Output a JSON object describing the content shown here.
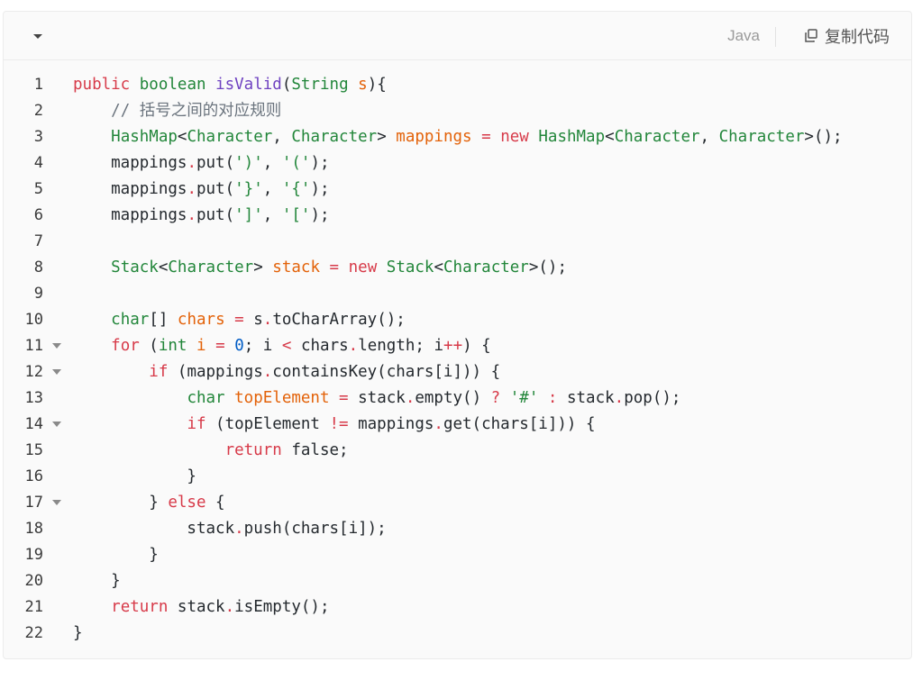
{
  "toolbar": {
    "language": "Java",
    "copy_label": "复制代码",
    "collapse_icon": "chevron-down-icon",
    "copy_icon": "copy-icon"
  },
  "colors": {
    "background": "#fafafa",
    "keyword": "#d73a49",
    "type": "#22863a",
    "function": "#6f42c1",
    "string": "#22863a",
    "number": "#005cc5",
    "comment": "#6a737d",
    "variable": "#e36209",
    "plain": "#24292e"
  },
  "code": {
    "lines": [
      {
        "number": "1",
        "foldable": false,
        "tokens": [
          {
            "t": "kw",
            "v": "public"
          },
          {
            "t": "pl",
            "v": " "
          },
          {
            "t": "type",
            "v": "boolean"
          },
          {
            "t": "pl",
            "v": " "
          },
          {
            "t": "fn",
            "v": "isValid"
          },
          {
            "t": "pl",
            "v": "("
          },
          {
            "t": "type",
            "v": "String"
          },
          {
            "t": "pl",
            "v": " "
          },
          {
            "t": "var",
            "v": "s"
          },
          {
            "t": "pl",
            "v": "){"
          }
        ]
      },
      {
        "number": "2",
        "foldable": false,
        "tokens": [
          {
            "t": "pl",
            "v": "    "
          },
          {
            "t": "cmt",
            "v": "// 括号之间的对应规则"
          }
        ]
      },
      {
        "number": "3",
        "foldable": false,
        "tokens": [
          {
            "t": "pl",
            "v": "    "
          },
          {
            "t": "type",
            "v": "HashMap"
          },
          {
            "t": "pl",
            "v": "<"
          },
          {
            "t": "type",
            "v": "Character"
          },
          {
            "t": "pl",
            "v": ", "
          },
          {
            "t": "type",
            "v": "Character"
          },
          {
            "t": "pl",
            "v": "> "
          },
          {
            "t": "var",
            "v": "mappings"
          },
          {
            "t": "pl",
            "v": " "
          },
          {
            "t": "op",
            "v": "="
          },
          {
            "t": "pl",
            "v": " "
          },
          {
            "t": "kw",
            "v": "new"
          },
          {
            "t": "pl",
            "v": " "
          },
          {
            "t": "type",
            "v": "HashMap"
          },
          {
            "t": "pl",
            "v": "<"
          },
          {
            "t": "type",
            "v": "Character"
          },
          {
            "t": "pl",
            "v": ", "
          },
          {
            "t": "type",
            "v": "Character"
          },
          {
            "t": "pl",
            "v": ">();"
          }
        ]
      },
      {
        "number": "4",
        "foldable": false,
        "tokens": [
          {
            "t": "pl",
            "v": "    mappings"
          },
          {
            "t": "op",
            "v": "."
          },
          {
            "t": "pl",
            "v": "put("
          },
          {
            "t": "str",
            "v": "')'"
          },
          {
            "t": "pl",
            "v": ", "
          },
          {
            "t": "str",
            "v": "'('"
          },
          {
            "t": "pl",
            "v": ");"
          }
        ]
      },
      {
        "number": "5",
        "foldable": false,
        "tokens": [
          {
            "t": "pl",
            "v": "    mappings"
          },
          {
            "t": "op",
            "v": "."
          },
          {
            "t": "pl",
            "v": "put("
          },
          {
            "t": "str",
            "v": "'}'"
          },
          {
            "t": "pl",
            "v": ", "
          },
          {
            "t": "str",
            "v": "'{'"
          },
          {
            "t": "pl",
            "v": ");"
          }
        ]
      },
      {
        "number": "6",
        "foldable": false,
        "tokens": [
          {
            "t": "pl",
            "v": "    mappings"
          },
          {
            "t": "op",
            "v": "."
          },
          {
            "t": "pl",
            "v": "put("
          },
          {
            "t": "str",
            "v": "']'"
          },
          {
            "t": "pl",
            "v": ", "
          },
          {
            "t": "str",
            "v": "'['"
          },
          {
            "t": "pl",
            "v": ");"
          }
        ]
      },
      {
        "number": "7",
        "foldable": false,
        "tokens": []
      },
      {
        "number": "8",
        "foldable": false,
        "tokens": [
          {
            "t": "pl",
            "v": "    "
          },
          {
            "t": "type",
            "v": "Stack"
          },
          {
            "t": "pl",
            "v": "<"
          },
          {
            "t": "type",
            "v": "Character"
          },
          {
            "t": "pl",
            "v": "> "
          },
          {
            "t": "var",
            "v": "stack"
          },
          {
            "t": "pl",
            "v": " "
          },
          {
            "t": "op",
            "v": "="
          },
          {
            "t": "pl",
            "v": " "
          },
          {
            "t": "kw",
            "v": "new"
          },
          {
            "t": "pl",
            "v": " "
          },
          {
            "t": "type",
            "v": "Stack"
          },
          {
            "t": "pl",
            "v": "<"
          },
          {
            "t": "type",
            "v": "Character"
          },
          {
            "t": "pl",
            "v": ">();"
          }
        ]
      },
      {
        "number": "9",
        "foldable": false,
        "tokens": []
      },
      {
        "number": "10",
        "foldable": false,
        "tokens": [
          {
            "t": "pl",
            "v": "    "
          },
          {
            "t": "type",
            "v": "char"
          },
          {
            "t": "pl",
            "v": "[] "
          },
          {
            "t": "var",
            "v": "chars"
          },
          {
            "t": "pl",
            "v": " "
          },
          {
            "t": "op",
            "v": "="
          },
          {
            "t": "pl",
            "v": " s"
          },
          {
            "t": "op",
            "v": "."
          },
          {
            "t": "pl",
            "v": "toCharArray();"
          }
        ]
      },
      {
        "number": "11",
        "foldable": true,
        "tokens": [
          {
            "t": "pl",
            "v": "    "
          },
          {
            "t": "kw",
            "v": "for"
          },
          {
            "t": "pl",
            "v": " ("
          },
          {
            "t": "type",
            "v": "int"
          },
          {
            "t": "pl",
            "v": " "
          },
          {
            "t": "var",
            "v": "i"
          },
          {
            "t": "pl",
            "v": " "
          },
          {
            "t": "op",
            "v": "="
          },
          {
            "t": "pl",
            "v": " "
          },
          {
            "t": "num",
            "v": "0"
          },
          {
            "t": "pl",
            "v": "; i "
          },
          {
            "t": "op",
            "v": "<"
          },
          {
            "t": "pl",
            "v": " chars"
          },
          {
            "t": "op",
            "v": "."
          },
          {
            "t": "pl",
            "v": "length; i"
          },
          {
            "t": "op",
            "v": "++"
          },
          {
            "t": "pl",
            "v": ") {"
          }
        ]
      },
      {
        "number": "12",
        "foldable": true,
        "tokens": [
          {
            "t": "pl",
            "v": "        "
          },
          {
            "t": "kw",
            "v": "if"
          },
          {
            "t": "pl",
            "v": " (mappings"
          },
          {
            "t": "op",
            "v": "."
          },
          {
            "t": "pl",
            "v": "containsKey(chars[i])) {"
          }
        ]
      },
      {
        "number": "13",
        "foldable": false,
        "tokens": [
          {
            "t": "pl",
            "v": "            "
          },
          {
            "t": "type",
            "v": "char"
          },
          {
            "t": "pl",
            "v": " "
          },
          {
            "t": "var",
            "v": "topElement"
          },
          {
            "t": "pl",
            "v": " "
          },
          {
            "t": "op",
            "v": "="
          },
          {
            "t": "pl",
            "v": " stack"
          },
          {
            "t": "op",
            "v": "."
          },
          {
            "t": "pl",
            "v": "empty() "
          },
          {
            "t": "op",
            "v": "?"
          },
          {
            "t": "pl",
            "v": " "
          },
          {
            "t": "str",
            "v": "'#'"
          },
          {
            "t": "pl",
            "v": " "
          },
          {
            "t": "op",
            "v": ":"
          },
          {
            "t": "pl",
            "v": " stack"
          },
          {
            "t": "op",
            "v": "."
          },
          {
            "t": "pl",
            "v": "pop();"
          }
        ]
      },
      {
        "number": "14",
        "foldable": true,
        "tokens": [
          {
            "t": "pl",
            "v": "            "
          },
          {
            "t": "kw",
            "v": "if"
          },
          {
            "t": "pl",
            "v": " (topElement "
          },
          {
            "t": "op",
            "v": "!="
          },
          {
            "t": "pl",
            "v": " mappings"
          },
          {
            "t": "op",
            "v": "."
          },
          {
            "t": "pl",
            "v": "get(chars[i])) {"
          }
        ]
      },
      {
        "number": "15",
        "foldable": false,
        "tokens": [
          {
            "t": "pl",
            "v": "                "
          },
          {
            "t": "kw",
            "v": "return"
          },
          {
            "t": "pl",
            "v": " false;"
          }
        ]
      },
      {
        "number": "16",
        "foldable": false,
        "tokens": [
          {
            "t": "pl",
            "v": "            }"
          }
        ]
      },
      {
        "number": "17",
        "foldable": true,
        "tokens": [
          {
            "t": "pl",
            "v": "        } "
          },
          {
            "t": "kw",
            "v": "else"
          },
          {
            "t": "pl",
            "v": " {"
          }
        ]
      },
      {
        "number": "18",
        "foldable": false,
        "tokens": [
          {
            "t": "pl",
            "v": "            stack"
          },
          {
            "t": "op",
            "v": "."
          },
          {
            "t": "pl",
            "v": "push(chars[i]);"
          }
        ]
      },
      {
        "number": "19",
        "foldable": false,
        "tokens": [
          {
            "t": "pl",
            "v": "        }"
          }
        ]
      },
      {
        "number": "20",
        "foldable": false,
        "tokens": [
          {
            "t": "pl",
            "v": "    }"
          }
        ]
      },
      {
        "number": "21",
        "foldable": false,
        "tokens": [
          {
            "t": "pl",
            "v": "    "
          },
          {
            "t": "kw",
            "v": "return"
          },
          {
            "t": "pl",
            "v": " stack"
          },
          {
            "t": "op",
            "v": "."
          },
          {
            "t": "pl",
            "v": "isEmpty();"
          }
        ]
      },
      {
        "number": "22",
        "foldable": false,
        "tokens": [
          {
            "t": "pl",
            "v": "}"
          }
        ]
      }
    ]
  }
}
